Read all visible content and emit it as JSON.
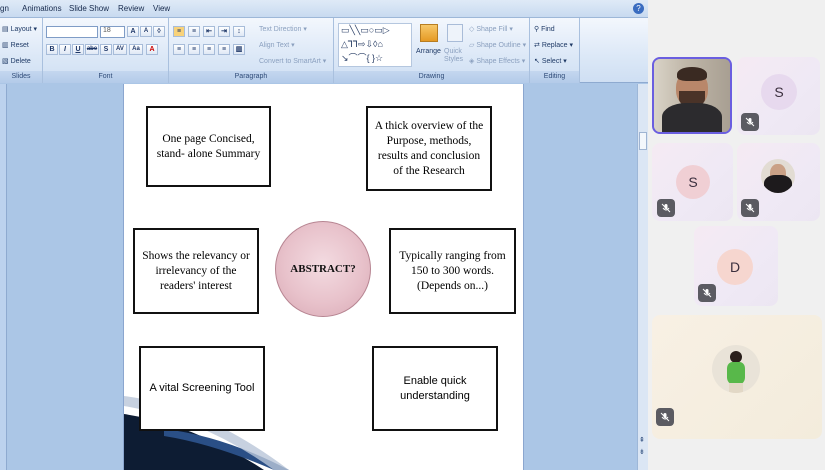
{
  "menu": {
    "items": [
      "gn",
      "Animations",
      "Slide Show",
      "Review",
      "View"
    ]
  },
  "ribbon": {
    "slides": {
      "layout": "Layout",
      "reset": "Reset",
      "delete": "Delete",
      "label": "Slides"
    },
    "font": {
      "size": "18",
      "label": "Font",
      "bold": "B",
      "italic": "I",
      "underline": "U",
      "strike": "abe",
      "shadow": "S",
      "spacing": "AV",
      "case": "Aa",
      "grow": "A",
      "shrink": "A"
    },
    "paragraph": {
      "text_direction": "Text Direction",
      "align_text": "Align Text",
      "smartart": "Convert to SmartArt",
      "label": "Paragraph"
    },
    "drawing": {
      "arrange": "Arrange",
      "quick_styles": "Quick Styles",
      "shape_fill": "Shape Fill",
      "shape_outline": "Shape Outline",
      "shape_effects": "Shape Effects",
      "label": "Drawing"
    },
    "editing": {
      "find": "Find",
      "replace": "Replace",
      "select": "Select",
      "label": "Editing"
    }
  },
  "slide": {
    "center": "ABSTRACT?",
    "boxes": {
      "b1": "One page Concised,\nstand- alone Summary",
      "b2": "A thick overview of the\nPurpose, methods,\nresults and conclusion\nof the Research",
      "b3": "Shows the relevancy or\nirrelevancy of the\nreaders' interest",
      "b4": "Typically ranging from\n150 to 300 words.\n(Depends on...)",
      "b5": "A vital Screening Tool",
      "b6": "Enable quick\nunderstanding"
    }
  },
  "participants": [
    {
      "initial": "S",
      "color": "#e9dcef"
    },
    {
      "initial": "S",
      "color": "#f1d2d6"
    },
    {
      "initial": "D",
      "color": "#f6d7d0"
    }
  ]
}
